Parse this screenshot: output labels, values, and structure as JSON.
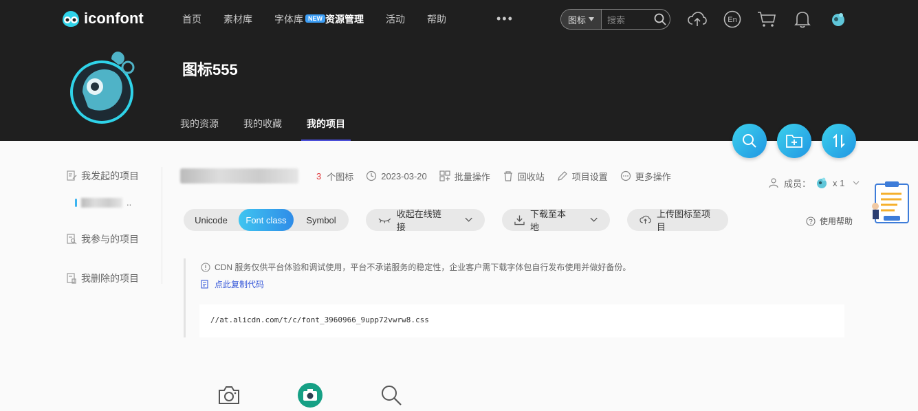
{
  "header": {
    "logo_text": "iconfont",
    "nav": [
      {
        "label": "首页"
      },
      {
        "label": "素材库"
      },
      {
        "label": "字体库",
        "badge": "NEW"
      },
      {
        "label": "资源管理",
        "active": true
      },
      {
        "label": "活动"
      },
      {
        "label": "帮助"
      }
    ],
    "more": "•••",
    "search": {
      "type_label": "图标",
      "placeholder": "搜索"
    },
    "icons": [
      "upload-cloud-icon",
      "language-en-icon",
      "cart-icon",
      "bell-icon",
      "user-avatar-icon"
    ],
    "lang_label": "En"
  },
  "profile": {
    "title": "图标555",
    "tabs": [
      {
        "label": "我的资源"
      },
      {
        "label": "我的收藏"
      },
      {
        "label": "我的项目",
        "active": true
      }
    ]
  },
  "fabs": [
    "search-icon",
    "new-folder-icon",
    "sort-icon"
  ],
  "sidebar": {
    "items": [
      {
        "label": "我发起的项目",
        "icon": "edit-doc-icon"
      },
      {
        "label": "我参与的项目",
        "icon": "search-doc-icon"
      },
      {
        "label": "我删除的项目",
        "icon": "trash-doc-icon"
      }
    ],
    "sub_item_suffix": ".."
  },
  "project": {
    "icon_count": "3",
    "icon_count_label": "个图标",
    "date": "2023-03-20",
    "actions": [
      {
        "label": "批量操作",
        "icon": "batch-icon"
      },
      {
        "label": "回收站",
        "icon": "recycle-icon"
      },
      {
        "label": "项目设置",
        "icon": "settings-pen-icon"
      },
      {
        "label": "更多操作",
        "icon": "more-circle-icon"
      }
    ],
    "members_label": "成员：",
    "members_count": "x 1"
  },
  "toolbar": {
    "segments": [
      {
        "label": "Unicode"
      },
      {
        "label": "Font class",
        "active": true
      },
      {
        "label": "Symbol"
      }
    ],
    "collapse_label": "收起在线链接",
    "download_label": "下载至本地",
    "upload_label": "上传图标至项目",
    "help_label": "使用帮助"
  },
  "code_area": {
    "notice": "CDN 服务仅供平台体验和调试使用，平台不承诺服务的稳定性，企业客户需下载字体包自行发布使用并做好备份。",
    "copy_label": "点此复制代码",
    "code": "//at.alicdn.com/t/c/font_3960966_9upp72vwrw8.css"
  },
  "colors": {
    "header_bg": "#1f1f1f",
    "accent_blue": "#2f8ce8",
    "accent_cyan": "#3fc5f0",
    "count_red": "#e0383b",
    "link_blue": "#3a5bd9"
  }
}
